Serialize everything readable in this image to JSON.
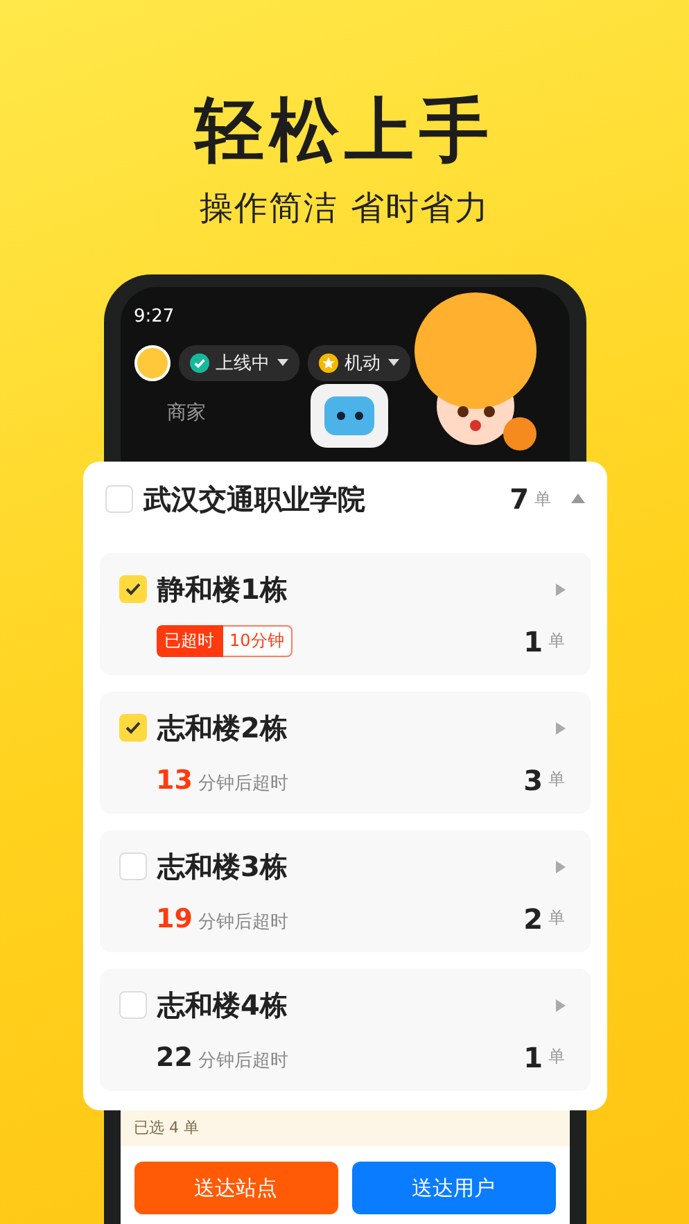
{
  "headline": "轻松上手",
  "subheadline": "操作简洁 省时省力",
  "phone": {
    "status_time": "9:27",
    "status_chips": [
      {
        "label": "上线中",
        "kind": "online"
      },
      {
        "label": "机动",
        "kind": "mode"
      }
    ],
    "tab": "商家",
    "group": {
      "name": "武汉交通职业学院",
      "checked": false,
      "expanded": true,
      "count": "7",
      "unit": "单",
      "buildings": [
        {
          "name": "静和楼1栋",
          "checked": true,
          "timing": {
            "kind": "overdue",
            "badge": "已超时",
            "duration": "10分钟"
          },
          "count": "1",
          "unit": "单"
        },
        {
          "name": "志和楼2栋",
          "checked": true,
          "timing": {
            "kind": "countdown",
            "minutes": "13",
            "urgent": true,
            "suffix": "分钟后超时"
          },
          "count": "3",
          "unit": "单"
        },
        {
          "name": "志和楼3栋",
          "checked": false,
          "timing": {
            "kind": "countdown",
            "minutes": "19",
            "urgent": true,
            "suffix": "分钟后超时"
          },
          "count": "2",
          "unit": "单"
        },
        {
          "name": "志和楼4栋",
          "checked": false,
          "timing": {
            "kind": "countdown",
            "minutes": "22",
            "urgent": false,
            "suffix": "分钟后超时"
          },
          "count": "1",
          "unit": "单"
        }
      ]
    },
    "selection_bar": "已选 4 单",
    "buttons": [
      {
        "label": "送达站点",
        "kind": "station"
      },
      {
        "label": "送达用户",
        "kind": "user"
      }
    ]
  }
}
